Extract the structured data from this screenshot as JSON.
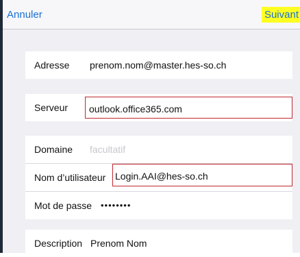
{
  "navbar": {
    "cancel_label": "Annuler",
    "next_label": "Suivant"
  },
  "fields": {
    "address": {
      "label": "Adresse",
      "value": "prenom.nom@master.hes-so.ch"
    },
    "server": {
      "label": "Serveur",
      "value": "outlook.office365.com"
    },
    "domain": {
      "label": "Domaine",
      "placeholder": "facultatif"
    },
    "username": {
      "label": "Nom d’utilisateur",
      "value": "Login.AAI@hes-so.ch"
    },
    "password": {
      "label": "Mot de passe",
      "value": "••••••••"
    },
    "description": {
      "label": "Description",
      "value": "Prenom Nom"
    }
  },
  "colors": {
    "accent": "#1a6fd6",
    "highlight": "#ffff22",
    "annotation_border": "#c0262d"
  }
}
